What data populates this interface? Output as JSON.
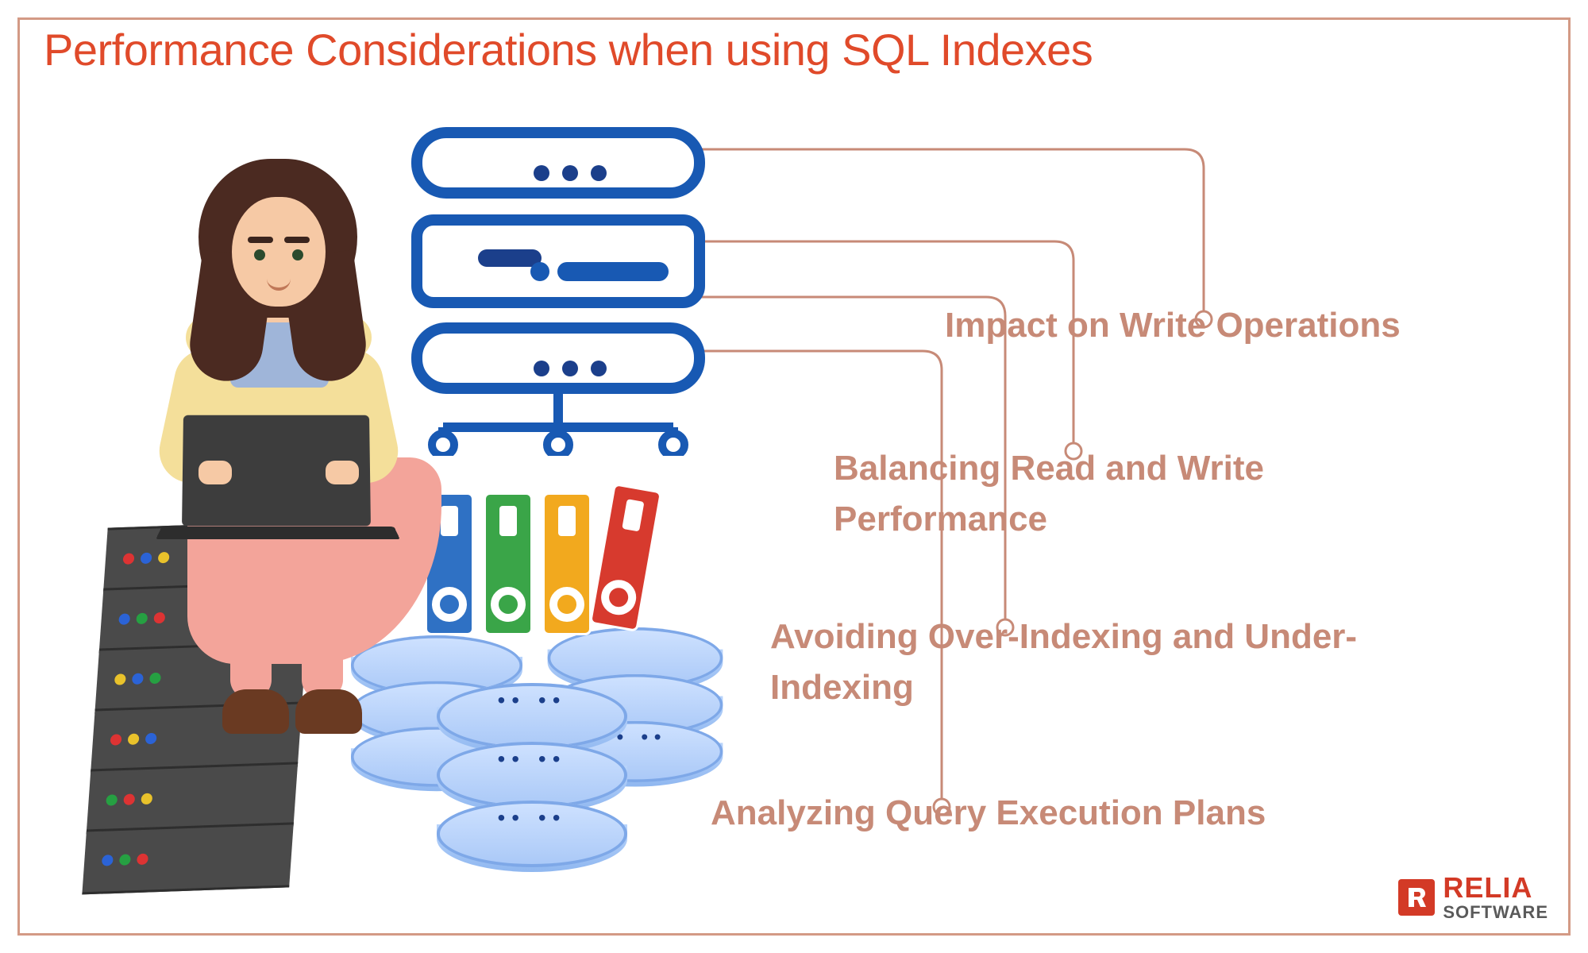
{
  "title": "Performance Considerations when using SQL Indexes",
  "items": {
    "i1": "Impact on Write Operations",
    "i2": "Balancing Read and Write Performance",
    "i3": "Avoiding Over-Indexing and Under-Indexing",
    "i4": "Analyzing Query Execution Plans"
  },
  "logo": {
    "line1": "RELIA",
    "line2": "SOFTWARE"
  },
  "colors": {
    "accent": "#e04a2a",
    "connector": "#c78a77",
    "server_outline": "#1859b3",
    "brand": "#d33a26"
  },
  "illustration": {
    "person": "woman-with-laptop",
    "seat": "server-tower",
    "center_icon": "server-rack-icon",
    "binders": [
      "blue",
      "green",
      "yellow",
      "red"
    ],
    "databases": 3
  }
}
